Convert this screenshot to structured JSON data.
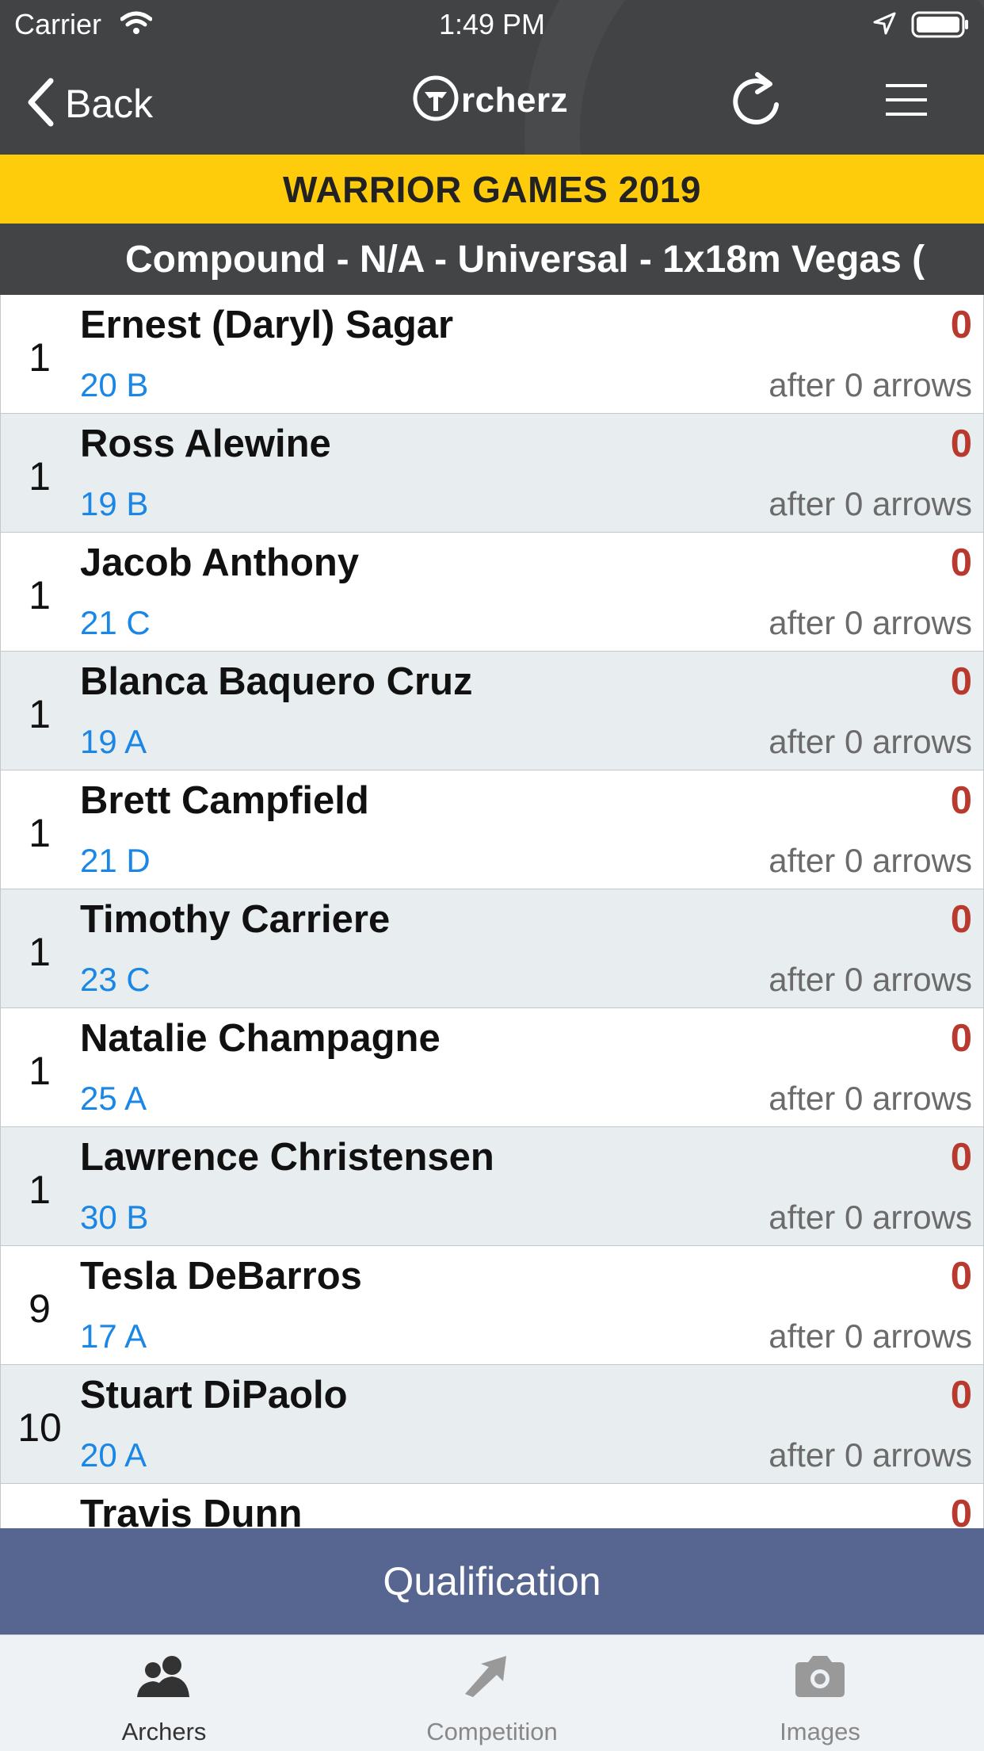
{
  "status_bar": {
    "carrier": "Carrier",
    "time": "1:49 PM"
  },
  "nav": {
    "back_label": "Back",
    "logo_text": "rcherz"
  },
  "event": {
    "title": "WARRIOR GAMES 2019"
  },
  "category": {
    "title": "Compound - N/A - Universal - 1x18m Vegas ("
  },
  "archers": [
    {
      "rank": "1",
      "name": "Ernest (Daryl) Sagar",
      "target": "20 B",
      "score": "0",
      "arrows": "after 0 arrows"
    },
    {
      "rank": "1",
      "name": "Ross Alewine",
      "target": "19 B",
      "score": "0",
      "arrows": "after 0 arrows"
    },
    {
      "rank": "1",
      "name": "Jacob Anthony",
      "target": "21 C",
      "score": "0",
      "arrows": "after 0 arrows"
    },
    {
      "rank": "1",
      "name": "Blanca Baquero Cruz",
      "target": "19 A",
      "score": "0",
      "arrows": "after 0 arrows"
    },
    {
      "rank": "1",
      "name": "Brett Campfield",
      "target": "21 D",
      "score": "0",
      "arrows": "after 0 arrows"
    },
    {
      "rank": "1",
      "name": "Timothy Carriere",
      "target": "23 C",
      "score": "0",
      "arrows": "after 0 arrows"
    },
    {
      "rank": "1",
      "name": "Natalie Champagne",
      "target": "25 A",
      "score": "0",
      "arrows": "after 0 arrows"
    },
    {
      "rank": "1",
      "name": "Lawrence Christensen",
      "target": "30 B",
      "score": "0",
      "arrows": "after 0 arrows"
    },
    {
      "rank": "9",
      "name": "Tesla DeBarros",
      "target": "17 A",
      "score": "0",
      "arrows": "after 0 arrows"
    },
    {
      "rank": "10",
      "name": "Stuart DiPaolo",
      "target": "20 A",
      "score": "0",
      "arrows": "after 0 arrows"
    },
    {
      "rank": "",
      "name": "Travis Dunn",
      "target": "",
      "score": "0",
      "arrows": ""
    }
  ],
  "round": {
    "label": "Qualification"
  },
  "tabs": [
    {
      "label": "Archers",
      "icon": "archers-icon",
      "active": true
    },
    {
      "label": "Competition",
      "icon": "competition-icon",
      "active": false
    },
    {
      "label": "Images",
      "icon": "camera-icon",
      "active": false
    }
  ],
  "colors": {
    "header": "#414344",
    "banner": "#ffcc0c",
    "score": "#b83a2f",
    "target": "#1a86e6",
    "round_bar": "#566690"
  }
}
